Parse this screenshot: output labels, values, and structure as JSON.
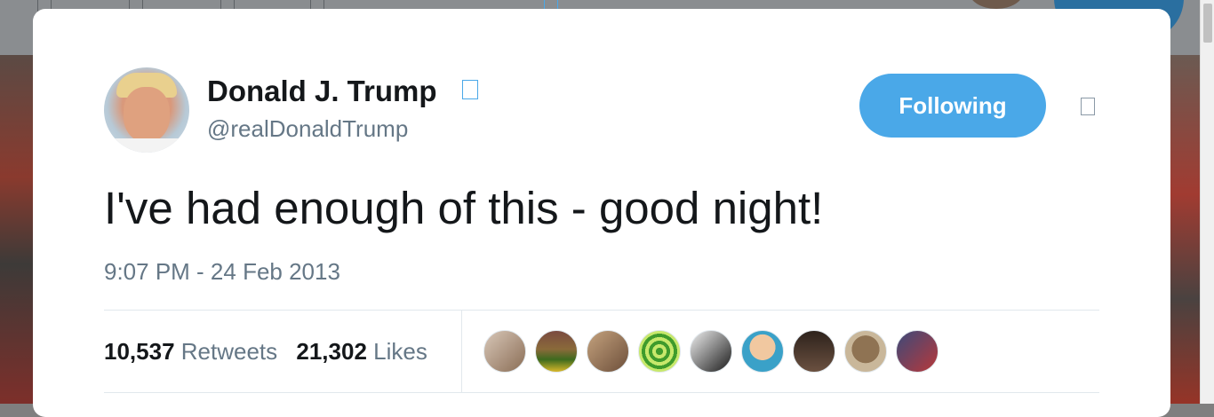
{
  "tweet": {
    "author_name": "Donald J. Trump",
    "author_handle": "@realDonaldTrump",
    "follow_label": "Following",
    "text": "I've had enough of this - good night!",
    "timestamp": "9:07 PM - 24 Feb 2013",
    "retweets_count": "10,537",
    "retweets_label": "Retweets",
    "likes_count": "21,302",
    "likes_label": "Likes"
  },
  "colors": {
    "follow_button": "#4aa8e8",
    "verified_badge": "#4aa8e8",
    "secondary_text": "#657786",
    "primary_text": "#14171a"
  },
  "icons": {
    "verified": "verified-badge-icon",
    "menu": "chevron-down-icon"
  },
  "likers": [
    {
      "fill": "linear-gradient(135deg,#d8c7b8,#8a6d55)"
    },
    {
      "fill": "linear-gradient(180deg,#7a4a40 0%,#8a6a3a 45%,#3d6a1e 70%,#d8b72a 100%)"
    },
    {
      "fill": "linear-gradient(135deg,#c4a27e,#6d4f3a)"
    },
    {
      "fill": "repeating-radial-gradient(circle,#3f9b2c 0 4px,#c7e86b 4px 8px)"
    },
    {
      "fill": "linear-gradient(135deg,#efefef,#1b1b1b)"
    },
    {
      "fill": "radial-gradient(circle at 50% 40%,#f1c8a0 0 40%,#3aa1c8 41%)"
    },
    {
      "fill": "linear-gradient(180deg,#2d221c,#6b5040)"
    },
    {
      "fill": "radial-gradient(circle at 50% 45%,#8f7353 0 45%,#c9b79a 46%)"
    },
    {
      "fill": "linear-gradient(135deg,#3c4a7a,#b8383a)"
    }
  ]
}
